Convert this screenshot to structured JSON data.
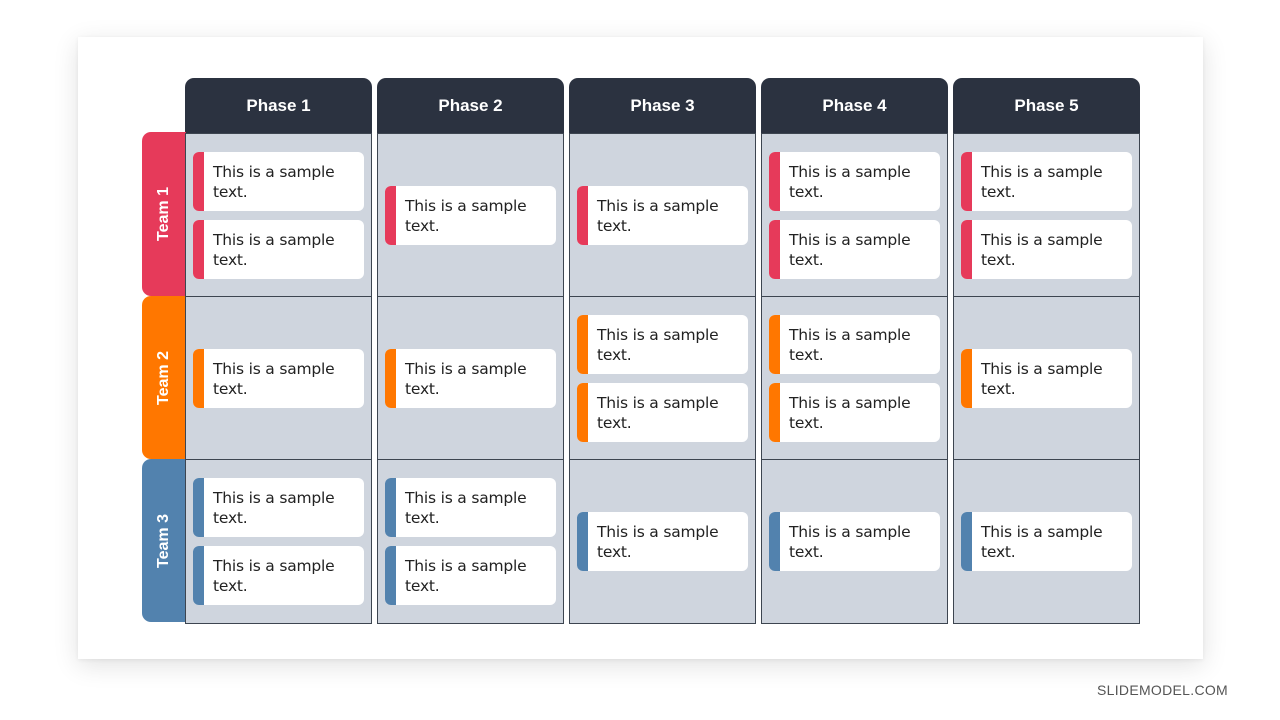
{
  "colors": {
    "header_bg": "#2b3240",
    "cell_bg": "#cfd5de",
    "team1": "#e63a5a",
    "team2": "#ff7700",
    "team3": "#5282ae"
  },
  "phases": [
    "Phase 1",
    "Phase 2",
    "Phase 3",
    "Phase 4",
    "Phase 5"
  ],
  "teams": [
    "Team 1",
    "Team 2",
    "Team 3"
  ],
  "card_text": "This is a sample text.",
  "grid": [
    [
      [
        "This is a sample text.",
        "This is a sample text."
      ],
      [
        "This is a sample text."
      ],
      [
        "This is a sample text."
      ],
      [
        "This is a sample text.",
        "This is a sample text."
      ],
      [
        "This is a sample text.",
        "This is a sample text."
      ]
    ],
    [
      [
        "This is a sample text."
      ],
      [
        "This is a sample text."
      ],
      [
        "This is a sample text.",
        "This is a sample text."
      ],
      [
        "This is a sample text.",
        "This is a sample text."
      ],
      [
        "This is a sample text."
      ]
    ],
    [
      [
        "This is a sample text.",
        "This is a sample text."
      ],
      [
        "This is a sample text.",
        "This is a sample text."
      ],
      [
        "This is a sample text."
      ],
      [
        "This is a sample text."
      ],
      [
        "This is a sample text."
      ]
    ]
  ],
  "footer": "SLIDEMODEL.COM"
}
